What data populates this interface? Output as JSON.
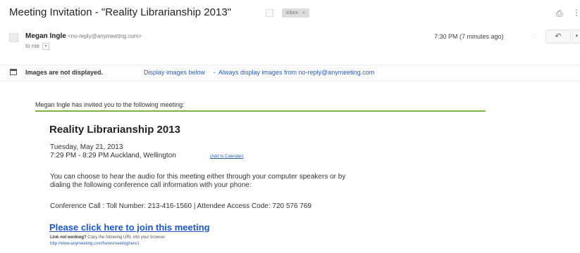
{
  "header": {
    "subject": "Meeting Invitation - \"Reality Librarianship 2013\"",
    "label": "Inbox",
    "label_close": "x",
    "icons": [
      "important-marker-icon",
      "print-icon",
      "more-icon"
    ]
  },
  "sender": {
    "name": "Megan Ingle",
    "email": "<no-reply@anymeeting.com>",
    "to": "to me",
    "time": "7:30 PM (7 minutes ago)",
    "icons": [
      "avatar-icon",
      "star-icon",
      "reply-icon",
      "dropdown-icon"
    ]
  },
  "images_notice": {
    "warning": "Images are not displayed.",
    "display_below": "Display images below",
    "separator": "-",
    "always_display": "Always display images from no-reply@anymeeting.com"
  },
  "invitation": {
    "intro": "Megan Ingle has invited you to the following meeting:",
    "title": "Reality Librarianship 2013",
    "date": "Tuesday, May 21, 2013",
    "time": "7:29 PM - 8:29 PM Auckland, Wellington",
    "add_to_calendar": "(Add to Calendar)",
    "audio_line1": "You can choose to hear the audio for this meeting either through your computer speakers or by",
    "audio_line2": "dialing the following conference call information with your phone:",
    "conference": "Conference Call : Toll Number: 213-416-1560 | Attendee Access Code: 720 576 769",
    "join_link": "Please click here to join this meeting",
    "link_not_working": "Link not working?",
    "copy_instructions": "Copy the following URL into your browser",
    "url": "http://www.anymeeting.com/heresmeetinghere1"
  },
  "colors": {
    "accent_green": "#7cb342",
    "link_blue": "#2a5db0",
    "join_blue": "#1a57c8"
  }
}
